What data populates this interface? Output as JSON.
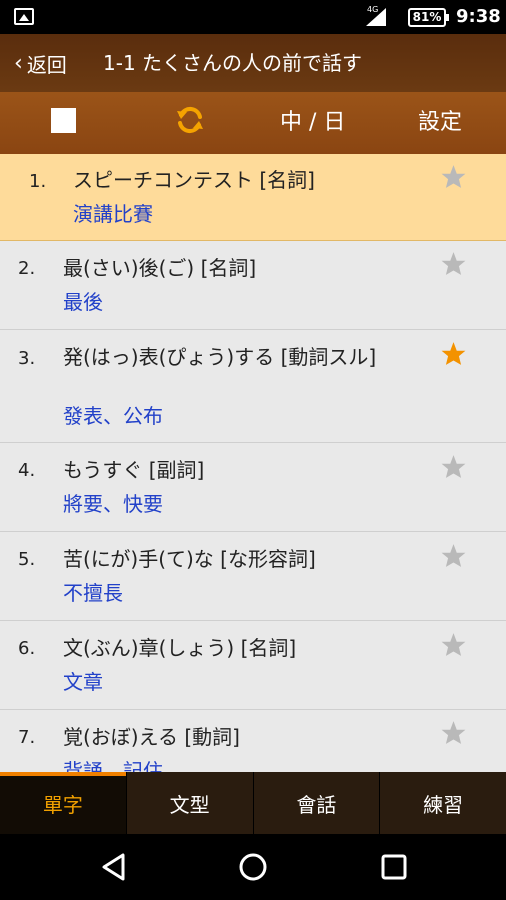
{
  "status_bar": {
    "network": "4G",
    "battery": "81%",
    "time": "9:38"
  },
  "header": {
    "back_label": "返回",
    "title": "1-1 たくさんの人の前で話す"
  },
  "toolbar": {
    "language_toggle": "中 / 日",
    "settings": "設定"
  },
  "words": [
    {
      "num": "1.",
      "word": "スピーチコンテスト [名詞]",
      "meaning": "演講比賽",
      "favorite": false,
      "selected": true
    },
    {
      "num": "2.",
      "word": "最(さい)後(ご) [名詞]",
      "meaning": "最後",
      "favorite": false,
      "selected": false
    },
    {
      "num": "3.",
      "word": "発(はっ)表(ぴょう)する [動詞スル]",
      "meaning": "發表、公布",
      "favorite": true,
      "selected": false
    },
    {
      "num": "4.",
      "word": "もうすぐ [副詞]",
      "meaning": "將要、快要",
      "favorite": false,
      "selected": false
    },
    {
      "num": "5.",
      "word": "苦(にが)手(て)な [な形容詞]",
      "meaning": "不擅長",
      "favorite": false,
      "selected": false
    },
    {
      "num": "6.",
      "word": "文(ぶん)章(しょう) [名詞]",
      "meaning": "文章",
      "favorite": false,
      "selected": false
    },
    {
      "num": "7.",
      "word": "覚(おぼ)える [動詞]",
      "meaning": "背誦、記住",
      "favorite": false,
      "selected": false
    }
  ],
  "tabs": [
    {
      "label": "單字",
      "active": true
    },
    {
      "label": "文型",
      "active": false
    },
    {
      "label": "會話",
      "active": false
    },
    {
      "label": "練習",
      "active": false
    }
  ],
  "colors": {
    "header_bg": "#5a2d0d",
    "toolbar_bg": "#9b5418",
    "selected_row": "#fedb9a",
    "meaning_text": "#2241c9",
    "star_on": "#f39200",
    "star_off": "#b9b9b9",
    "tab_active": "#f0a000"
  },
  "icons": {
    "status": [
      "image-icon",
      "signal-icon",
      "battery-icon"
    ],
    "toolbar": [
      "checkbox-icon",
      "refresh-icon"
    ],
    "navbar": [
      "back-triangle-icon",
      "home-circle-icon",
      "recents-square-icon"
    ]
  }
}
